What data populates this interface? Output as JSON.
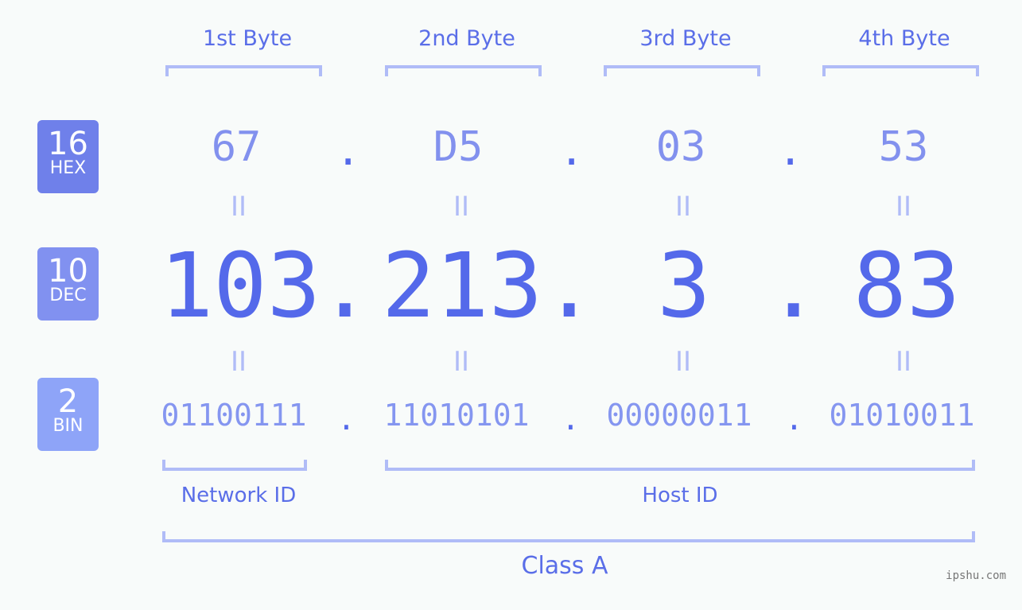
{
  "badges": [
    {
      "num": "16",
      "label": "HEX",
      "color": "#6f80ea"
    },
    {
      "num": "10",
      "label": "DEC",
      "color": "#8191f0"
    },
    {
      "num": "2",
      "label": "BIN",
      "color": "#8ea4f8"
    }
  ],
  "byte_labels": [
    "1st Byte",
    "2nd Byte",
    "3rd Byte",
    "4th Byte"
  ],
  "hex": [
    "67",
    "D5",
    "03",
    "53"
  ],
  "dec": [
    "103",
    "213",
    "3",
    "83"
  ],
  "bin": [
    "01100111",
    "11010101",
    "00000011",
    "01010011"
  ],
  "separator": ".",
  "equals": "II",
  "network_id_label": "Network ID",
  "host_id_label": "Host ID",
  "class_label": "Class A",
  "watermark": "ipshu.com",
  "colors": {
    "accent": "#5469ea",
    "bracket": "#b0bcf7",
    "background": "#f8fbfa"
  }
}
